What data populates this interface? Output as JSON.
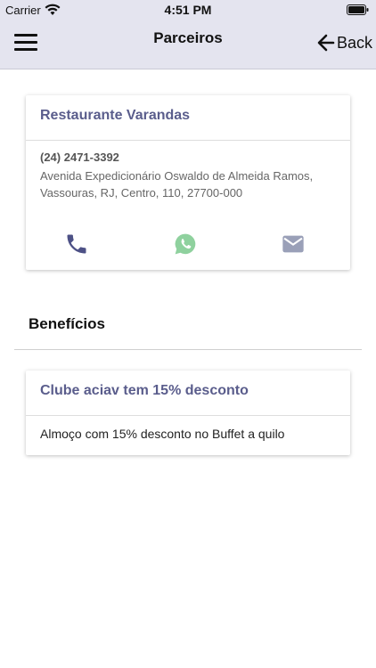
{
  "status_bar": {
    "carrier": "Carrier",
    "time": "4:51 PM"
  },
  "header": {
    "title": "Parceiros",
    "back_label": "Back"
  },
  "partner": {
    "name": "Restaurante Varandas",
    "phone": "(24) 2471-3392",
    "address": "Avenida Expedicionário Oswaldo de Almeida Ramos, Vassouras, RJ, Centro, 110, 27700-000"
  },
  "actions": {
    "phone_icon": "phone-icon",
    "whatsapp_icon": "whatsapp-icon",
    "mail_icon": "mail-icon"
  },
  "benefits": {
    "heading": "Benefícios",
    "items": [
      {
        "title": "Clube aciav tem 15% desconto",
        "description": "Almoço com 15% desconto no Buffet a quilo"
      }
    ]
  },
  "colors": {
    "header_bg": "#e4e4ef",
    "accent": "#5a5d8c",
    "whatsapp": "#8fd19e",
    "mail": "#9aa0b8"
  }
}
